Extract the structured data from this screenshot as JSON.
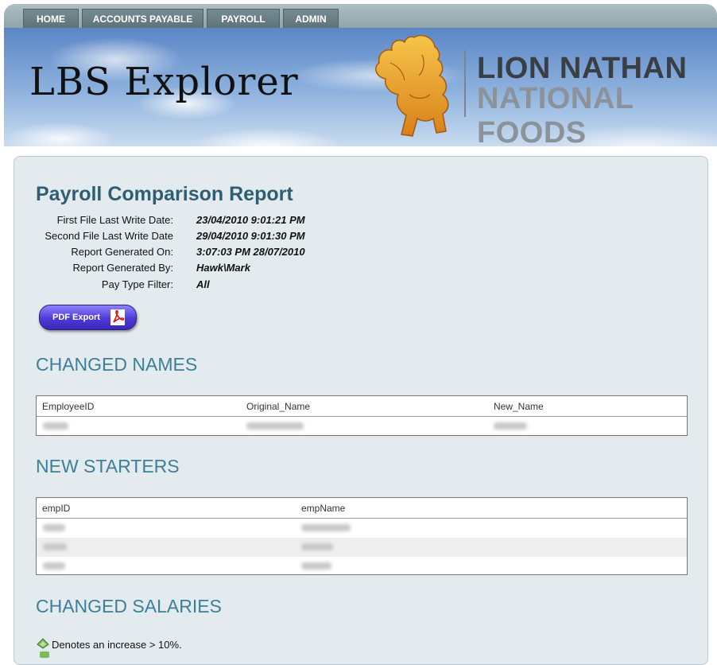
{
  "nav": {
    "tabs": [
      "HOME",
      "ACCOUNTS PAYABLE",
      "PAYROLL",
      "ADMIN"
    ]
  },
  "banner": {
    "app_title": "LBS Explorer",
    "brand_line1": "LION NATHAN",
    "brand_line2": "NATIONAL FOODS"
  },
  "report": {
    "title": "Payroll Comparison Report",
    "meta": [
      {
        "label": "First File Last Write Date:",
        "value": "23/04/2010 9:01:21 PM"
      },
      {
        "label": "Second File Last Write Date",
        "value": "29/04/2010 9:01:30 PM"
      },
      {
        "label": "Report Generated On:",
        "value": "3:07:03 PM 28/07/2010"
      },
      {
        "label": "Report Generated By:",
        "value": "Hawk\\Mark"
      },
      {
        "label": "Pay Type Filter:",
        "value": "All"
      }
    ],
    "pdf_button": "PDF Export"
  },
  "sections": {
    "changed_names": {
      "heading": "CHANGED NAMES",
      "columns": [
        "EmployeeID",
        "Original_Name",
        "New_Name"
      ]
    },
    "new_starters": {
      "heading": "NEW STARTERS",
      "columns": [
        "empID",
        "empName"
      ]
    },
    "changed_salaries": {
      "heading": "CHANGED SALARIES",
      "legend_increase": "Denotes an increase > 10%."
    }
  },
  "colors": {
    "heading": "#3d7e98",
    "title": "#2f5d72",
    "panel": "#e4ebef",
    "pdf_button": "#4e3bd6"
  }
}
